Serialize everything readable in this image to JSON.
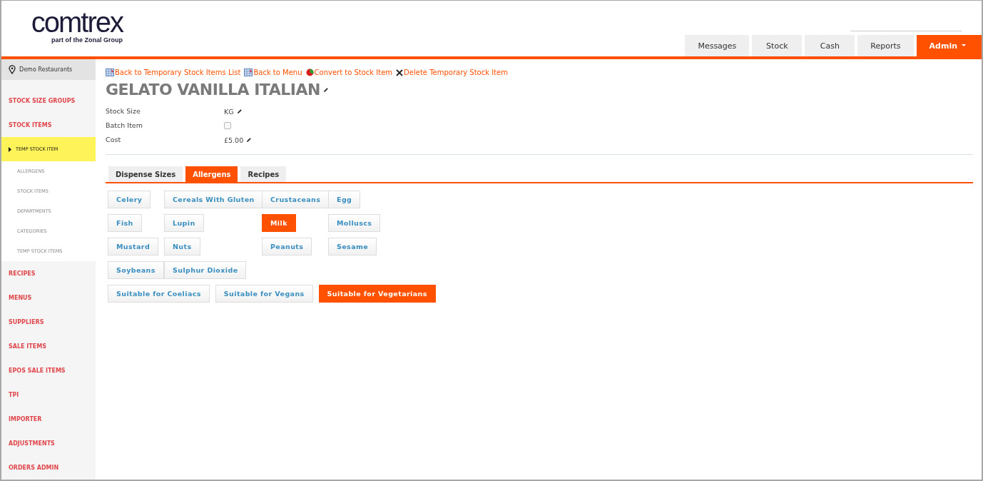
{
  "header": {
    "logo": "comtrex",
    "logo_tagline": "part of the Zonal Group"
  },
  "nav": [
    {
      "label": "Messages",
      "selected": false
    },
    {
      "label": "Stock",
      "selected": false
    },
    {
      "label": "Cash",
      "selected": false
    },
    {
      "label": "Reports",
      "selected": false
    },
    {
      "label": "Admin",
      "selected": true
    }
  ],
  "sidebar": {
    "site": "Demo Restaurants",
    "items": [
      {
        "label": "STOCK SIZE GROUPS",
        "selected": false
      },
      {
        "label": "STOCK ITEMS",
        "selected": false,
        "children": [
          {
            "label": "TEMP STOCK ITEM",
            "selected": true
          },
          {
            "label": "ALLERGENS",
            "selected": false
          },
          {
            "label": "STOCK ITEMS",
            "selected": false
          },
          {
            "label": "DEPARTMENTS",
            "selected": false
          },
          {
            "label": "CATEGORIES",
            "selected": false
          },
          {
            "label": "TEMP STOCK ITEMS",
            "selected": false
          }
        ]
      },
      {
        "label": "RECIPES",
        "selected": false
      },
      {
        "label": "MENUS",
        "selected": false
      },
      {
        "label": "SUPPLIERS",
        "selected": false
      },
      {
        "label": "SALE ITEMS",
        "selected": false
      },
      {
        "label": "EPOS SALE ITEMS",
        "selected": false
      },
      {
        "label": "TPI",
        "selected": false
      },
      {
        "label": "IMPORTER",
        "selected": false
      },
      {
        "label": "ADJUSTMENTS",
        "selected": false
      },
      {
        "label": "ORDERS ADMIN",
        "selected": false
      }
    ]
  },
  "actions": [
    {
      "kind": "list",
      "label": "Back to Temporary Stock Items List"
    },
    {
      "kind": "list",
      "label": "Back to Menu"
    },
    {
      "kind": "convert",
      "label": "Convert to Stock Item"
    },
    {
      "kind": "delete",
      "label": "Delete Temporary Stock Item"
    }
  ],
  "title": "GELATO VANILLA ITALIAN",
  "fields": [
    {
      "kind": "text",
      "label": "Stock Size",
      "value": "KG"
    },
    {
      "kind": "checkbox",
      "label": "Batch Item",
      "checked": false
    },
    {
      "kind": "text",
      "label": "Cost",
      "value": "£5.00"
    }
  ],
  "tabs": [
    {
      "label": "Dispense Sizes",
      "selected": false
    },
    {
      "label": "Allergens",
      "selected": true
    },
    {
      "label": "Recipes",
      "selected": false
    }
  ],
  "allergens": [
    {
      "label": "Celery",
      "selected": false
    },
    {
      "label": "Cereals With Gluten",
      "selected": false
    },
    {
      "label": "Crustaceans",
      "selected": false
    },
    {
      "label": "Egg",
      "selected": false
    },
    {
      "label": "Fish",
      "selected": false
    },
    {
      "label": "Lupin",
      "selected": false
    },
    {
      "label": "Milk",
      "selected": true
    },
    {
      "label": "Molluscs",
      "selected": false
    },
    {
      "label": "Mustard",
      "selected": false
    },
    {
      "label": "Nuts",
      "selected": false
    },
    {
      "label": "Peanuts",
      "selected": false
    },
    {
      "label": "Sesame",
      "selected": false
    },
    {
      "label": "Soybeans",
      "selected": false
    },
    {
      "label": "Sulphur Dioxide",
      "selected": false
    }
  ],
  "dietary": [
    {
      "label": "Suitable for Coeliacs",
      "selected": false
    },
    {
      "label": "Suitable for Vegans",
      "selected": false
    },
    {
      "label": "Suitable for Vegetarians",
      "selected": true
    }
  ]
}
